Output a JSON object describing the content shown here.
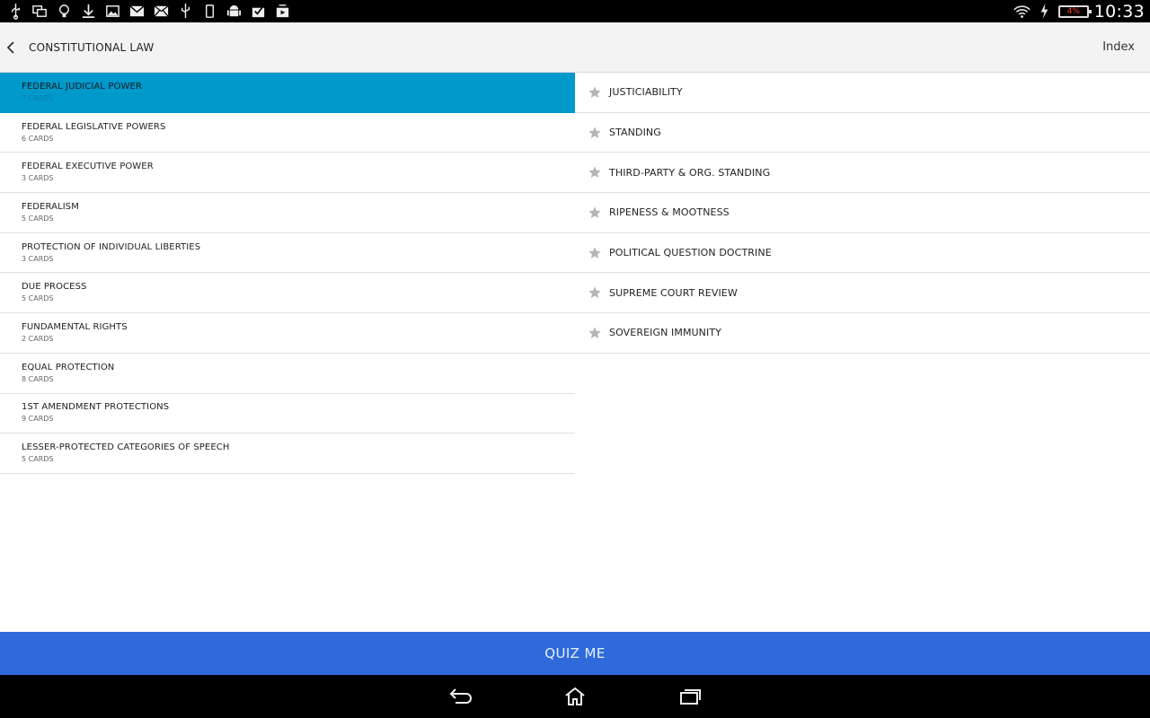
{
  "status_bar": {
    "icons": [
      "usb-icon",
      "screen-mirror-icon",
      "lightbulb-icon",
      "download-icon",
      "image-icon",
      "gmail-icon",
      "email-icon",
      "usb-debug-icon",
      "tablet-icon",
      "android-icon",
      "clipboard-check-icon",
      "media-download-icon"
    ],
    "battery": "4%",
    "time": "10:33"
  },
  "header": {
    "title": "CONSTITUTIONAL LAW",
    "index_label": "Index"
  },
  "chapters": [
    {
      "title": "FEDERAL JUDICIAL POWER",
      "count": "7 CARDS",
      "selected": true
    },
    {
      "title": "FEDERAL LEGISLATIVE POWERS",
      "count": "6 CARDS"
    },
    {
      "title": "FEDERAL EXECUTIVE POWER",
      "count": "3 CARDS"
    },
    {
      "title": "FEDERALISM",
      "count": "5 CARDS"
    },
    {
      "title": "PROTECTION OF INDIVIDUAL LIBERTIES",
      "count": "3 CARDS"
    },
    {
      "title": "DUE PROCESS",
      "count": "5 CARDS"
    },
    {
      "title": "FUNDAMENTAL RIGHTS",
      "count": "2 CARDS"
    },
    {
      "title": "EQUAL PROTECTION",
      "count": "8 CARDS"
    },
    {
      "title": "1ST AMENDMENT PROTECTIONS",
      "count": "9 CARDS"
    },
    {
      "title": "LESSER-PROTECTED CATEGORIES OF SPEECH",
      "count": "5 CARDS"
    }
  ],
  "topics": [
    {
      "label": "JUSTICIABILITY"
    },
    {
      "label": "STANDING"
    },
    {
      "label": "THIRD-PARTY & ORG. STANDING"
    },
    {
      "label": "RIPENESS & MOOTNESS"
    },
    {
      "label": "POLITICAL QUESTION DOCTRINE"
    },
    {
      "label": "SUPREME COURT REVIEW"
    },
    {
      "label": "SOVEREIGN IMMUNITY"
    }
  ],
  "quiz_button": {
    "label": "QUIZ ME"
  },
  "nav": [
    "back-icon",
    "home-icon",
    "recent-apps-icon"
  ],
  "colors": {
    "selected": "#0099cc",
    "quiz": "#2e6ad9",
    "star": "#b5b5b5"
  }
}
